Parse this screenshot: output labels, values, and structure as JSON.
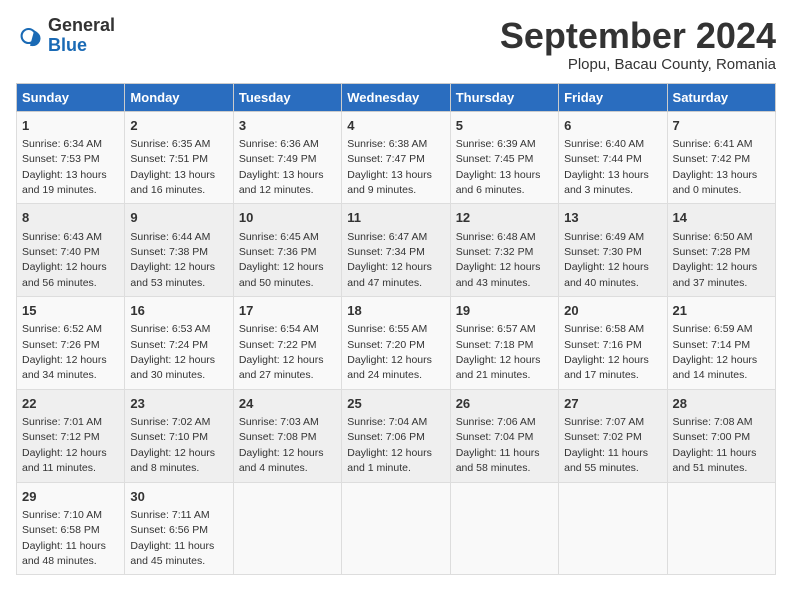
{
  "header": {
    "logo_general": "General",
    "logo_blue": "Blue",
    "month_title": "September 2024",
    "location": "Plopu, Bacau County, Romania"
  },
  "columns": [
    "Sunday",
    "Monday",
    "Tuesday",
    "Wednesday",
    "Thursday",
    "Friday",
    "Saturday"
  ],
  "weeks": [
    [
      {
        "day": "1",
        "sunrise": "6:34 AM",
        "sunset": "7:53 PM",
        "daylight": "13 hours and 19 minutes."
      },
      {
        "day": "2",
        "sunrise": "6:35 AM",
        "sunset": "7:51 PM",
        "daylight": "13 hours and 16 minutes."
      },
      {
        "day": "3",
        "sunrise": "6:36 AM",
        "sunset": "7:49 PM",
        "daylight": "13 hours and 12 minutes."
      },
      {
        "day": "4",
        "sunrise": "6:38 AM",
        "sunset": "7:47 PM",
        "daylight": "13 hours and 9 minutes."
      },
      {
        "day": "5",
        "sunrise": "6:39 AM",
        "sunset": "7:45 PM",
        "daylight": "13 hours and 6 minutes."
      },
      {
        "day": "6",
        "sunrise": "6:40 AM",
        "sunset": "7:44 PM",
        "daylight": "13 hours and 3 minutes."
      },
      {
        "day": "7",
        "sunrise": "6:41 AM",
        "sunset": "7:42 PM",
        "daylight": "13 hours and 0 minutes."
      }
    ],
    [
      {
        "day": "8",
        "sunrise": "6:43 AM",
        "sunset": "7:40 PM",
        "daylight": "12 hours and 56 minutes."
      },
      {
        "day": "9",
        "sunrise": "6:44 AM",
        "sunset": "7:38 PM",
        "daylight": "12 hours and 53 minutes."
      },
      {
        "day": "10",
        "sunrise": "6:45 AM",
        "sunset": "7:36 PM",
        "daylight": "12 hours and 50 minutes."
      },
      {
        "day": "11",
        "sunrise": "6:47 AM",
        "sunset": "7:34 PM",
        "daylight": "12 hours and 47 minutes."
      },
      {
        "day": "12",
        "sunrise": "6:48 AM",
        "sunset": "7:32 PM",
        "daylight": "12 hours and 43 minutes."
      },
      {
        "day": "13",
        "sunrise": "6:49 AM",
        "sunset": "7:30 PM",
        "daylight": "12 hours and 40 minutes."
      },
      {
        "day": "14",
        "sunrise": "6:50 AM",
        "sunset": "7:28 PM",
        "daylight": "12 hours and 37 minutes."
      }
    ],
    [
      {
        "day": "15",
        "sunrise": "6:52 AM",
        "sunset": "7:26 PM",
        "daylight": "12 hours and 34 minutes."
      },
      {
        "day": "16",
        "sunrise": "6:53 AM",
        "sunset": "7:24 PM",
        "daylight": "12 hours and 30 minutes."
      },
      {
        "day": "17",
        "sunrise": "6:54 AM",
        "sunset": "7:22 PM",
        "daylight": "12 hours and 27 minutes."
      },
      {
        "day": "18",
        "sunrise": "6:55 AM",
        "sunset": "7:20 PM",
        "daylight": "12 hours and 24 minutes."
      },
      {
        "day": "19",
        "sunrise": "6:57 AM",
        "sunset": "7:18 PM",
        "daylight": "12 hours and 21 minutes."
      },
      {
        "day": "20",
        "sunrise": "6:58 AM",
        "sunset": "7:16 PM",
        "daylight": "12 hours and 17 minutes."
      },
      {
        "day": "21",
        "sunrise": "6:59 AM",
        "sunset": "7:14 PM",
        "daylight": "12 hours and 14 minutes."
      }
    ],
    [
      {
        "day": "22",
        "sunrise": "7:01 AM",
        "sunset": "7:12 PM",
        "daylight": "12 hours and 11 minutes."
      },
      {
        "day": "23",
        "sunrise": "7:02 AM",
        "sunset": "7:10 PM",
        "daylight": "12 hours and 8 minutes."
      },
      {
        "day": "24",
        "sunrise": "7:03 AM",
        "sunset": "7:08 PM",
        "daylight": "12 hours and 4 minutes."
      },
      {
        "day": "25",
        "sunrise": "7:04 AM",
        "sunset": "7:06 PM",
        "daylight": "12 hours and 1 minute."
      },
      {
        "day": "26",
        "sunrise": "7:06 AM",
        "sunset": "7:04 PM",
        "daylight": "11 hours and 58 minutes."
      },
      {
        "day": "27",
        "sunrise": "7:07 AM",
        "sunset": "7:02 PM",
        "daylight": "11 hours and 55 minutes."
      },
      {
        "day": "28",
        "sunrise": "7:08 AM",
        "sunset": "7:00 PM",
        "daylight": "11 hours and 51 minutes."
      }
    ],
    [
      {
        "day": "29",
        "sunrise": "7:10 AM",
        "sunset": "6:58 PM",
        "daylight": "11 hours and 48 minutes."
      },
      {
        "day": "30",
        "sunrise": "7:11 AM",
        "sunset": "6:56 PM",
        "daylight": "11 hours and 45 minutes."
      },
      {
        "day": "",
        "sunrise": "",
        "sunset": "",
        "daylight": ""
      },
      {
        "day": "",
        "sunrise": "",
        "sunset": "",
        "daylight": ""
      },
      {
        "day": "",
        "sunrise": "",
        "sunset": "",
        "daylight": ""
      },
      {
        "day": "",
        "sunrise": "",
        "sunset": "",
        "daylight": ""
      },
      {
        "day": "",
        "sunrise": "",
        "sunset": "",
        "daylight": ""
      }
    ]
  ]
}
